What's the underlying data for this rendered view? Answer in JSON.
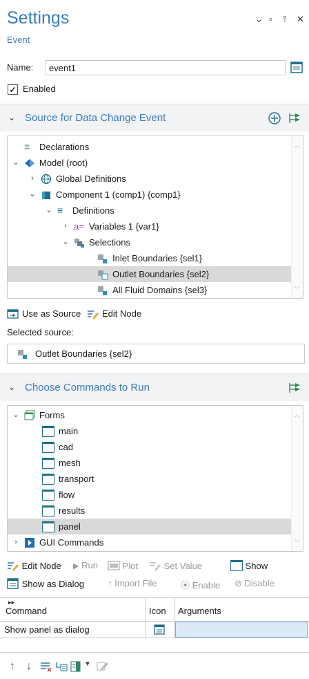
{
  "header": {
    "title": "Settings",
    "subtitle": "Event",
    "controls": [
      "⌄",
      "▫",
      "⫯",
      "✕"
    ]
  },
  "form": {
    "name_label": "Name:",
    "name_value": "event1",
    "enabled_label": "Enabled",
    "enabled_checked": true
  },
  "source_section": {
    "title": "Source for Data Change Event",
    "tree": [
      {
        "label": "Declarations",
        "icon": "declarations-icon",
        "selected": false
      },
      {
        "label": "Model (root)",
        "icon": "model-icon",
        "selected": false
      },
      {
        "label": "Global Definitions",
        "icon": "globe-icon",
        "selected": false
      },
      {
        "label": "Component 1 (comp1) {comp1}",
        "icon": "component-icon",
        "selected": false
      },
      {
        "label": "Definitions",
        "icon": "definitions-icon",
        "selected": false
      },
      {
        "label": "Variables 1 {var1}",
        "icon": "variables-icon",
        "selected": false
      },
      {
        "label": "Selections",
        "icon": "selections-icon",
        "selected": false
      },
      {
        "label": "Inlet Boundaries {sel1}",
        "icon": "selection-icon",
        "selected": false
      },
      {
        "label": "Outlet Boundaries {sel2}",
        "icon": "selection-icon",
        "selected": true
      },
      {
        "label": "All Fluid Domains {sel3}",
        "icon": "selection-icon",
        "selected": false
      }
    ],
    "use_as_source_label": "Use as Source",
    "edit_node_label": "Edit Node",
    "selected_source_label": "Selected source:",
    "selected_source_value": "Outlet Boundaries {sel2}"
  },
  "commands_section": {
    "title": "Choose Commands to Run",
    "tree": [
      {
        "label": "Forms",
        "icon": "forms-icon",
        "selected": false
      },
      {
        "label": "main",
        "icon": "form-icon",
        "selected": false
      },
      {
        "label": "cad",
        "icon": "form-icon",
        "selected": false
      },
      {
        "label": "mesh",
        "icon": "form-icon",
        "selected": false
      },
      {
        "label": "transport",
        "icon": "form-icon",
        "selected": false
      },
      {
        "label": "flow",
        "icon": "form-icon",
        "selected": false
      },
      {
        "label": "results",
        "icon": "form-icon",
        "selected": false
      },
      {
        "label": "panel",
        "icon": "form-icon",
        "selected": true
      },
      {
        "label": "GUI Commands",
        "icon": "gui-commands-icon",
        "selected": false
      }
    ],
    "toolbar": {
      "edit_node": "Edit Node",
      "run": "Run",
      "plot": "Plot",
      "set_value": "Set Value",
      "show": "Show",
      "show_as_dialog": "Show as Dialog",
      "import_file": "Import File",
      "enable": "Enable",
      "disable": "Disable"
    },
    "table": {
      "columns": [
        "Command",
        "Icon",
        "Arguments"
      ],
      "rows": [
        {
          "command": "Show panel as dialog",
          "arguments": ""
        }
      ]
    }
  },
  "colors": {
    "accent": "#3a7bbf",
    "teal": "#1f6f8b",
    "selected_row": "#d9d9d9",
    "args_cell": "#dceaf7"
  }
}
